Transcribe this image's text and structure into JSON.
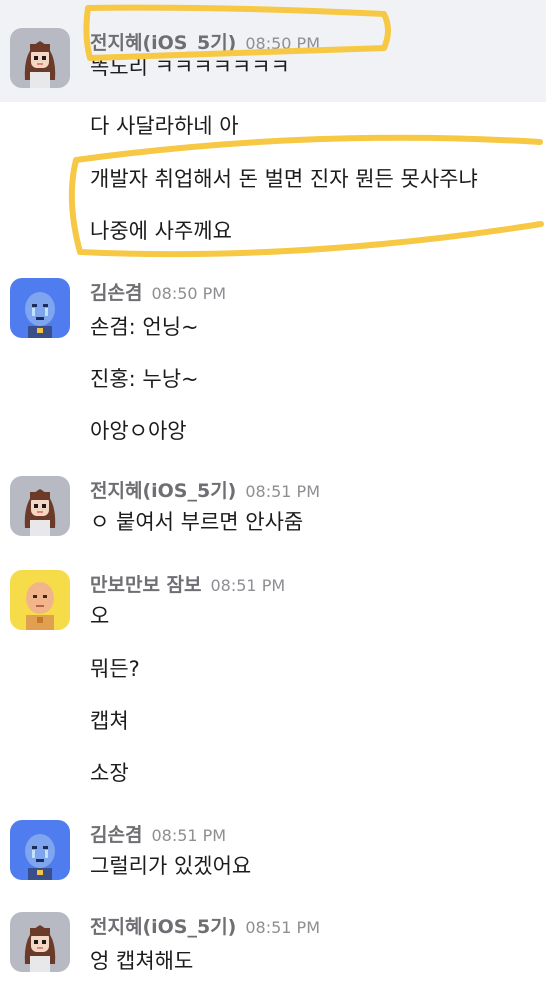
{
  "colors": {
    "highlight_bg": "#f1f2f5",
    "annotation": "#f6c843",
    "name": "#6e6e73",
    "time": "#8e8e93",
    "text": "#1d1c1d"
  },
  "groups": [
    {
      "avatar": "girl-avatar-icon",
      "sender": "전지혜(iOS_5기)",
      "time": "08:50 PM",
      "messages": [
        "똑노리 ㅋㅋㅋㅋㅋㅋㅋ",
        "다 사달라하네 아",
        "개발자 취업해서 돈 벌면 진자 뭔든 못사주냐",
        "나중에 사주께요"
      ]
    },
    {
      "avatar": "blue-crying-avatar-icon",
      "sender": "김손겸",
      "time": "08:50 PM",
      "messages": [
        "손겸: 언닝~",
        "진홍: 누낭~",
        "아앙ㅇ아앙"
      ]
    },
    {
      "avatar": "girl-avatar-icon",
      "sender": "전지혜(iOS_5기)",
      "time": "08:51 PM",
      "messages": [
        "ㅇ 붙여서 부르면 안사줌"
      ]
    },
    {
      "avatar": "bald-yellow-avatar-icon",
      "sender": "만보만보 잠보",
      "time": "08:51 PM",
      "messages": [
        "오",
        "뭐든?",
        "캡쳐",
        "소장"
      ]
    },
    {
      "avatar": "blue-crying-avatar-icon",
      "sender": "김손겸",
      "time": "08:51 PM",
      "messages": [
        "그럴리가 있겠어요"
      ]
    },
    {
      "avatar": "girl-avatar-icon",
      "sender": "전지혜(iOS_5기)",
      "time": "08:51 PM",
      "messages": [
        "엉 캡쳐해도"
      ]
    }
  ]
}
